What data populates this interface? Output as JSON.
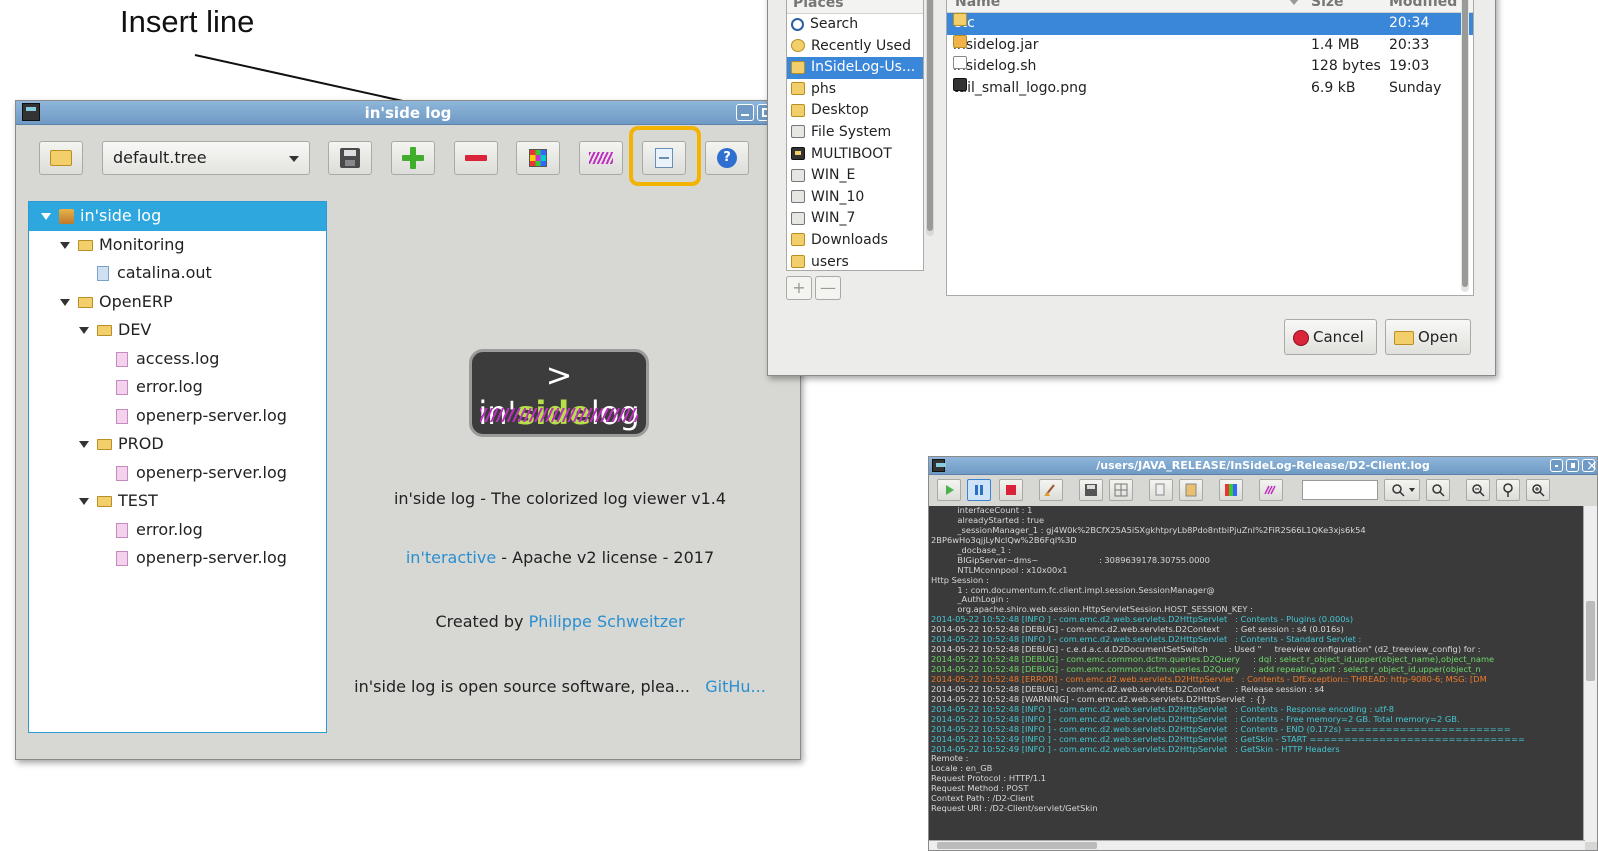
{
  "annotation": {
    "label": "Insert line"
  },
  "main_window": {
    "title": "in'side log",
    "toolbar": {
      "tree_file": "default.tree"
    },
    "tree": [
      {
        "label": "in'side log",
        "level": 0,
        "kind": "root",
        "expanded": true,
        "selected": true
      },
      {
        "label": "Monitoring",
        "level": 1,
        "kind": "folder",
        "expanded": true
      },
      {
        "label": "catalina.out",
        "level": 2,
        "kind": "file"
      },
      {
        "label": "OpenERP",
        "level": 1,
        "kind": "folder",
        "expanded": true
      },
      {
        "label": "DEV",
        "level": 2,
        "kind": "folder",
        "expanded": true
      },
      {
        "label": "access.log",
        "level": 3,
        "kind": "file-log"
      },
      {
        "label": "error.log",
        "level": 3,
        "kind": "file-log"
      },
      {
        "label": "openerp-server.log",
        "level": 3,
        "kind": "file-log"
      },
      {
        "label": "PROD",
        "level": 2,
        "kind": "folder",
        "expanded": true
      },
      {
        "label": "openerp-server.log",
        "level": 3,
        "kind": "file-log"
      },
      {
        "label": "TEST",
        "level": 2,
        "kind": "folder",
        "expanded": true
      },
      {
        "label": "error.log",
        "level": 3,
        "kind": "file-log"
      },
      {
        "label": "openerp-server.log",
        "level": 3,
        "kind": "file-log"
      }
    ],
    "about": {
      "logo_prefix": "> in'",
      "logo_side": "side",
      "logo_suffix": "log",
      "version_line": "in'side log - The colorized log viewer v1.4",
      "license_link": "in'teractive",
      "license_text": " - Apache v2 license - 2017",
      "created_by": "Created by ",
      "author_link": "Philippe Schweitzer",
      "opensource_text": "in'side log is open source software, plea...",
      "github_link": "GitHu..."
    }
  },
  "file_chooser": {
    "places_header": "Places",
    "places": [
      {
        "label": "Search",
        "icon": "search"
      },
      {
        "label": "Recently Used",
        "icon": "recent"
      },
      {
        "label": "InSideLog-Us...",
        "icon": "folder",
        "selected": true
      },
      {
        "label": "phs",
        "icon": "folder"
      },
      {
        "label": "Desktop",
        "icon": "folder"
      },
      {
        "label": "File System",
        "icon": "drive"
      },
      {
        "label": "MULTIBOOT",
        "icon": "usb"
      },
      {
        "label": "WIN_E",
        "icon": "drive"
      },
      {
        "label": "WIN_10",
        "icon": "drive"
      },
      {
        "label": "WIN_7",
        "icon": "drive"
      },
      {
        "label": "Downloads",
        "icon": "dl"
      },
      {
        "label": "users",
        "icon": "folder"
      }
    ],
    "add_label": "+",
    "remove_label": "—",
    "columns": {
      "name": "Name",
      "size": "Size",
      "modified": "Modified"
    },
    "files": [
      {
        "name": "etc",
        "size": "",
        "modified": "20:34",
        "icon": "folder",
        "selected": true
      },
      {
        "name": "insidelog.jar",
        "size": "1.4 MB",
        "modified": "20:33",
        "icon": "jar"
      },
      {
        "name": "insidelog.sh",
        "size": "128 bytes",
        "modified": "19:03",
        "icon": "sh"
      },
      {
        "name": "tail_small_logo.png",
        "size": "6.9 kB",
        "modified": "Sunday",
        "icon": "png"
      }
    ],
    "cancel_label": "Cancel",
    "open_label": "Open"
  },
  "log_window": {
    "title": "/users/JAVA_RELEASE/InSideLog-Release/D2-Client.log",
    "lines": [
      {
        "t": "plain",
        "text": "          interfaceCount : 1"
      },
      {
        "t": "plain",
        "text": "          alreadyStarted : true"
      },
      {
        "t": "plain",
        "text": "          _sessionManager_1 : gj4W0k%2BCfX25A5iSXgkhtpryLb8Pdo8ntbiPjuZnI%2FiR2S66L1QKe3xjs6k54"
      },
      {
        "t": "plain",
        "text": "2BP6wHo3qjjLyNclQw%2B6Fql%3D"
      },
      {
        "t": "plain",
        "text": "          _docbase_1 :"
      },
      {
        "t": "plain",
        "text": "          BIGipServer~dms~                       : 3089639178.30755.0000"
      },
      {
        "t": "plain",
        "text": "          NTLMconnpool : x10x00x1"
      },
      {
        "t": "plain",
        "text": "Http Session :"
      },
      {
        "t": "plain",
        "text": "          1 : com.documentum.fc.client.impl.session.SessionManager@"
      },
      {
        "t": "plain",
        "text": "          _AuthLogin :"
      },
      {
        "t": "plain",
        "text": "          org.apache.shiro.web.session.HttpServletSession.HOST_SESSION_KEY :"
      },
      {
        "t": "info",
        "text": "2014-05-22 10:52:48 [INFO ] - com.emc.d2.web.servlets.D2HttpServlet   : Contents - Plugins (0.000s)"
      },
      {
        "t": "plain",
        "text": "2014-05-22 10:52:48 [DEBUG] - com.emc.d2.web.servlets.D2Context      : Get session : s4 (0.016s)"
      },
      {
        "t": "info",
        "text": "2014-05-22 10:52:48 [INFO ] - com.emc.d2.web.servlets.D2HttpServlet   : Contents - Standard Servlet :"
      },
      {
        "t": "plain",
        "text": "2014-05-22 10:52:48 [DEBUG] - c.e.d.a.c.d.D2DocumentSetSwitch        : Used \"     treeview configuration\" (d2_treeview_config) for :"
      },
      {
        "t": "debug",
        "text": "2014-05-22 10:52:48 [DEBUG] - com.emc.common.dctm.queries.D2Query     : dql : select r_object_id,upper(object_name),object_name"
      },
      {
        "t": "debug",
        "text": "2014-05-22 10:52:48 [DEBUG] - com.emc.common.dctm.queries.D2Query     : add repeating sort : select r_object_id,upper(object_n"
      },
      {
        "t": "error",
        "text": "2014-05-22 10:52:48 [ERROR] - com.emc.d2.web.servlets.D2HttpServlet   : Contents - DfException:: THREAD: http-9080-6; MSG: [DM"
      },
      {
        "t": "plain",
        "text": "2014-05-22 10:52:48 [DEBUG] - com.emc.d2.web.servlets.D2Context      : Release session : s4"
      },
      {
        "t": "plain",
        "text": "2014-05-22 10:52:48 [WARNING] - com.emc.d2.web.servlets.D2HttpServlet  : {}"
      },
      {
        "t": "info",
        "text": "2014-05-22 10:52:48 [INFO ] - com.emc.d2.web.servlets.D2HttpServlet   : Contents - Response encoding : utf-8"
      },
      {
        "t": "info",
        "text": "2014-05-22 10:52:48 [INFO ] - com.emc.d2.web.servlets.D2HttpServlet   : Contents - Free memory=2 GB. Total memory=2 GB."
      },
      {
        "t": "info",
        "text": "2014-05-22 10:52:48 [INFO ] - com.emc.d2.web.servlets.D2HttpServlet   : Contents - END (0.172s) ========================"
      },
      {
        "t": "info",
        "text": "2014-05-22 10:52:49 [INFO ] - com.emc.d2.web.servlets.D2HttpServlet   : GetSkin - START ==============================="
      },
      {
        "t": "info",
        "text": "2014-05-22 10:52:49 [INFO ] - com.emc.d2.web.servlets.D2HttpServlet   : GetSkin - HTTP Headers"
      },
      {
        "t": "plain",
        "text": "Remote :"
      },
      {
        "t": "plain",
        "text": "Locale : en_GB"
      },
      {
        "t": "plain",
        "text": "Request Protocol : HTTP/1.1"
      },
      {
        "t": "plain",
        "text": "Request Method : POST"
      },
      {
        "t": "plain",
        "text": "Context Path : /D2-Client"
      },
      {
        "t": "plain",
        "text": "Request URI : /D2-Client/servlet/GetSkin"
      }
    ]
  }
}
